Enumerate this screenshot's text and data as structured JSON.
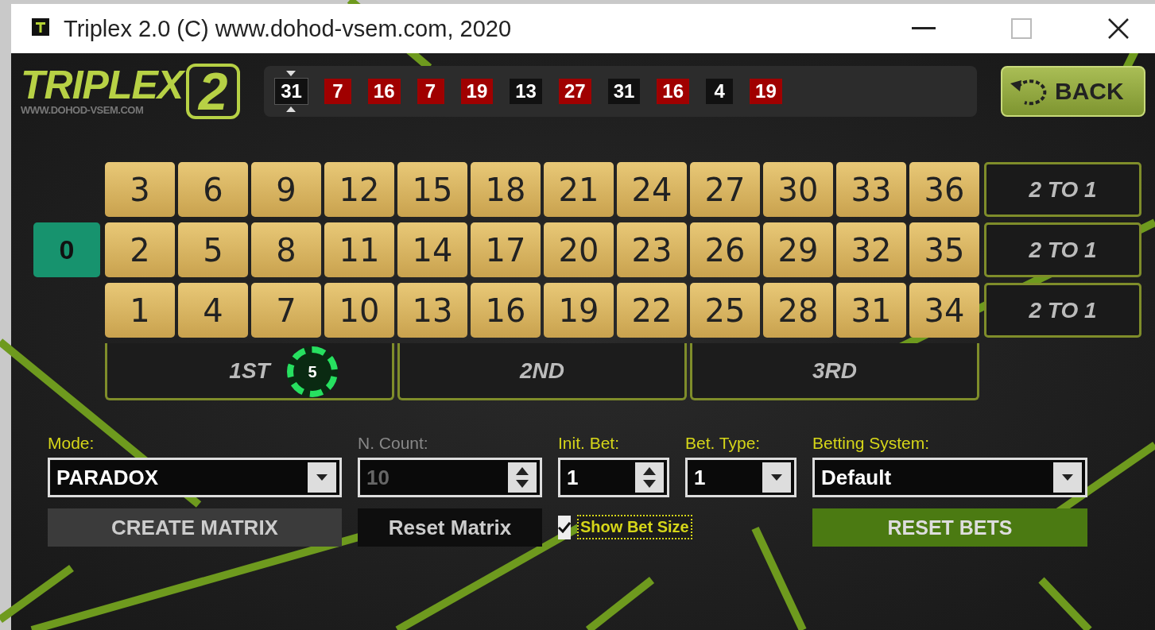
{
  "window": {
    "title": "Triplex 2.0 (C) www.dohod-vsem.com, 2020"
  },
  "logo": {
    "name": "TRIPLEX",
    "version": "2",
    "site": "WWW.DOHOD-VSEM.COM"
  },
  "history": [
    {
      "number": "31",
      "color": "#111111",
      "selected": true
    },
    {
      "number": "7",
      "color": "#a00000",
      "selected": false
    },
    {
      "number": "16",
      "color": "#a00000",
      "selected": false
    },
    {
      "number": "7",
      "color": "#a00000",
      "selected": false
    },
    {
      "number": "19",
      "color": "#a00000",
      "selected": false
    },
    {
      "number": "13",
      "color": "#111111",
      "selected": false
    },
    {
      "number": "27",
      "color": "#a00000",
      "selected": false
    },
    {
      "number": "31",
      "color": "#111111",
      "selected": false
    },
    {
      "number": "16",
      "color": "#a00000",
      "selected": false
    },
    {
      "number": "4",
      "color": "#111111",
      "selected": false
    },
    {
      "number": "19",
      "color": "#a00000",
      "selected": false
    }
  ],
  "back_button": "BACK",
  "table": {
    "rows": [
      [
        "3",
        "6",
        "9",
        "12",
        "15",
        "18",
        "21",
        "24",
        "27",
        "30",
        "33",
        "36"
      ],
      [
        "2",
        "5",
        "8",
        "11",
        "14",
        "17",
        "20",
        "23",
        "26",
        "29",
        "32",
        "35"
      ],
      [
        "1",
        "4",
        "7",
        "10",
        "13",
        "16",
        "19",
        "22",
        "25",
        "28",
        "31",
        "34"
      ]
    ],
    "column_bets": [
      "2 TO 1",
      "2 TO 1",
      "2 TO 1"
    ],
    "zero": "0",
    "dozens": [
      {
        "label": "1ST",
        "chip": "5"
      },
      {
        "label": "2ND"
      },
      {
        "label": "3RD"
      }
    ]
  },
  "controls": {
    "mode": {
      "label": "Mode:",
      "value": "PARADOX"
    },
    "n_count": {
      "label": "N. Count:",
      "value": "10",
      "disabled": true
    },
    "init_bet": {
      "label": "Init. Bet:",
      "value": "1",
      "disabled": false
    },
    "bet_type": {
      "label": "Bet. Type:",
      "value": "1"
    },
    "betting_system": {
      "label": "Betting System:",
      "value": "Default"
    },
    "create_matrix": "CREATE MATRIX",
    "reset_matrix": "Reset Matrix",
    "show_bet_size": {
      "label": "Show Bet Size",
      "checked": true
    },
    "reset_bets": "RESET BETS"
  }
}
